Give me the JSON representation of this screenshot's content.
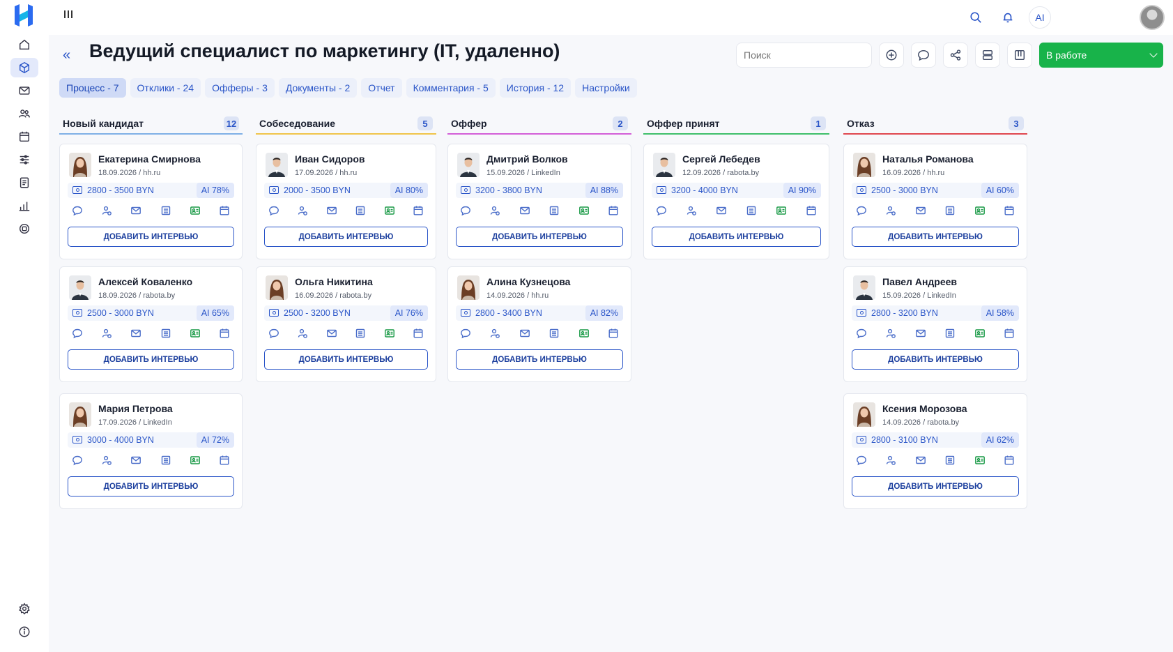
{
  "title": "Ведущий специалист по маркетингу (IT, удаленно)",
  "search": {
    "placeholder": "Поиск"
  },
  "topbar": {
    "ai_label": "AI"
  },
  "status": {
    "label": "В работе",
    "color": "#18b34a"
  },
  "tabs": [
    {
      "label": "Процесс - 7",
      "active": true
    },
    {
      "label": "Отклики - 24"
    },
    {
      "label": "Офферы - 3"
    },
    {
      "label": "Документы - 2"
    },
    {
      "label": "Отчет"
    },
    {
      "label": "Комментария - 5"
    },
    {
      "label": "История - 12"
    },
    {
      "label": "Настройки"
    }
  ],
  "card_action_label": "ДОБАВИТЬ ИНТЕРВЬЮ",
  "columns": [
    {
      "name": "Новый кандидат",
      "count": "12",
      "color": "#7fb0e6",
      "cards": [
        {
          "name": "Екатерина Смирнова",
          "meta": "18.09.2026 / hh.ru",
          "salary": "2800 - 3500 BYN",
          "ai": "AI 78%",
          "gender": "f"
        },
        {
          "name": "Алексей Коваленко",
          "meta": "18.09.2026 / rabota.by",
          "salary": "2500 - 3000 BYN",
          "ai": "AI 65%",
          "gender": "m"
        },
        {
          "name": "Мария Петрова",
          "meta": "17.09.2026 / LinkedIn",
          "salary": "3000 - 4000 BYN",
          "ai": "AI 72%",
          "gender": "f"
        }
      ]
    },
    {
      "name": "Собеседование",
      "count": "5",
      "color": "#f0c44a",
      "cards": [
        {
          "name": "Иван Сидоров",
          "meta": "17.09.2026 / hh.ru",
          "salary": "2000 - 3500 BYN",
          "ai": "AI 80%",
          "gender": "m"
        },
        {
          "name": "Ольга Никитина",
          "meta": "16.09.2026 / rabota.by",
          "salary": "2500 - 3200 BYN",
          "ai": "AI 76%",
          "gender": "f"
        }
      ]
    },
    {
      "name": "Оффер",
      "count": "2",
      "color": "#d35fd8",
      "cards": [
        {
          "name": "Дмитрий Волков",
          "meta": "15.09.2026 / LinkedIn",
          "salary": "3200 - 3800 BYN",
          "ai": "AI 88%",
          "gender": "m"
        },
        {
          "name": "Алина Кузнецова",
          "meta": "14.09.2026 / hh.ru",
          "salary": "2800 - 3400 BYN",
          "ai": "AI 82%",
          "gender": "f"
        }
      ]
    },
    {
      "name": "Оффер принят",
      "count": "1",
      "color": "#3fbf6a",
      "cards": [
        {
          "name": "Сергей Лебедев",
          "meta": "12.09.2026 / rabota.by",
          "salary": "3200 - 4000 BYN",
          "ai": "AI 90%",
          "gender": "m"
        }
      ]
    },
    {
      "name": "Отказ",
      "count": "3",
      "color": "#e0474f",
      "cards": [
        {
          "name": "Наталья Романова",
          "meta": "16.09.2026 / hh.ru",
          "salary": "2500 - 3000 BYN",
          "ai": "AI 60%",
          "gender": "f"
        },
        {
          "name": "Павел Андреев",
          "meta": "15.09.2026 / LinkedIn",
          "salary": "2800 - 3200 BYN",
          "ai": "AI 58%",
          "gender": "m"
        },
        {
          "name": "Ксения Морозова",
          "meta": "14.09.2026 / rabota.by",
          "salary": "2800 - 3100 BYN",
          "ai": "AI 62%",
          "gender": "f"
        }
      ]
    }
  ],
  "sidebar": {
    "items": [
      {
        "icon": "home-icon"
      },
      {
        "icon": "box-icon",
        "active": true
      },
      {
        "icon": "mail-icon"
      },
      {
        "icon": "users-icon"
      },
      {
        "icon": "calendar-icon"
      },
      {
        "icon": "filters-icon"
      },
      {
        "icon": "document-icon"
      },
      {
        "icon": "analytics-icon"
      },
      {
        "icon": "chip-icon"
      }
    ],
    "bottom": [
      {
        "icon": "settings-icon"
      },
      {
        "icon": "info-icon"
      }
    ]
  }
}
